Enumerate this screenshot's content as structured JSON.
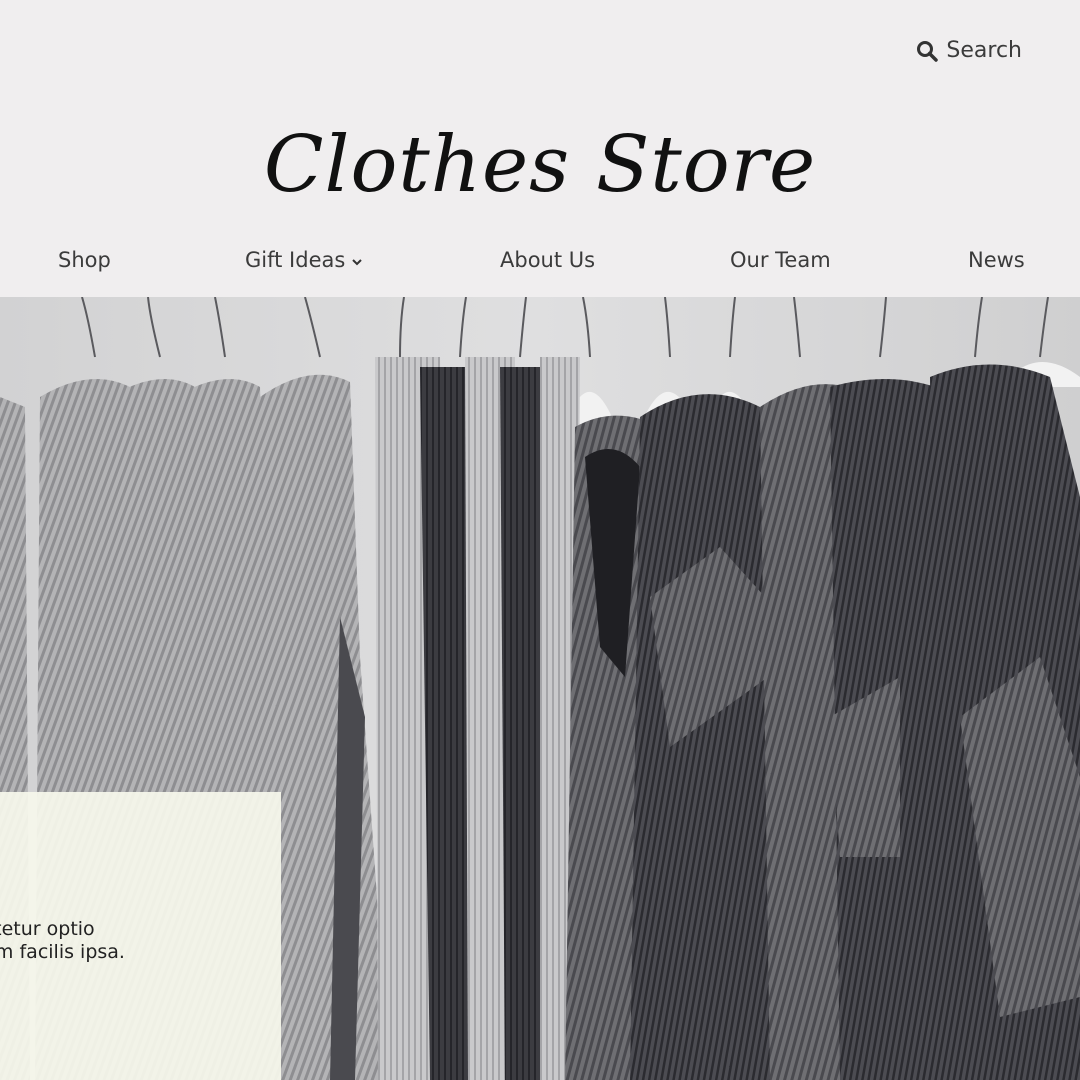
{
  "header": {
    "search_label": "Search",
    "search_icon": "search-icon",
    "logo_text": "Clothes Store"
  },
  "nav": {
    "items": [
      {
        "label": "Shop"
      },
      {
        "label": "Gift Ideas",
        "icon": "chevron-down-icon"
      },
      {
        "label": "About Us"
      },
      {
        "label": "Our Team"
      },
      {
        "label": "News"
      }
    ]
  },
  "card": {
    "text": "consectetur optio officiis m facilis ipsa."
  },
  "colors": {
    "background": "#f0eeef",
    "card": "#f6f7ec",
    "text": "#3b3b3b"
  }
}
